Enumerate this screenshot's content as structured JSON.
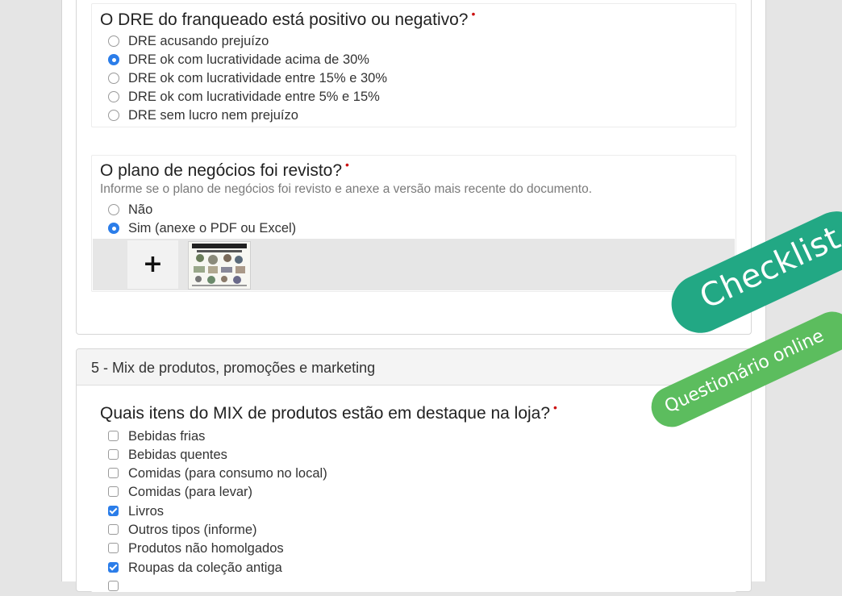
{
  "section_dre": {
    "question": "O DRE do franqueado está positivo ou negativo?",
    "required_mark": "•",
    "options": [
      {
        "label": "DRE acusando prejuízo",
        "selected": false
      },
      {
        "label": "DRE ok com lucratividade acima de 30%",
        "selected": true
      },
      {
        "label": "DRE ok com lucratividade entre 15% e 30%",
        "selected": false
      },
      {
        "label": "DRE ok com lucratividade entre 5% e 15%",
        "selected": false
      },
      {
        "label": "DRE sem lucro nem prejuízo",
        "selected": false
      }
    ]
  },
  "section_plano": {
    "question": "O plano de negócios foi revisto?",
    "required_mark": "•",
    "help": "Informe se o plano de negócios foi revisto e anexe a versão mais recente do documento.",
    "options": [
      {
        "label": "Não",
        "selected": false
      },
      {
        "label": "Sim (anexe o PDF ou Excel)",
        "selected": true
      }
    ],
    "add_attachment_label": "+"
  },
  "section5": {
    "header": "5 - Mix de produtos, promoções e marketing",
    "question": "Quais itens do MIX de produtos estão em destaque na loja?",
    "required_mark": "•",
    "options": [
      {
        "label": "Bebidas frias",
        "checked": false
      },
      {
        "label": "Bebidas quentes",
        "checked": false
      },
      {
        "label": "Comidas (para consumo no local)",
        "checked": false
      },
      {
        "label": "Comidas (para levar)",
        "checked": false
      },
      {
        "label": "Livros",
        "checked": true
      },
      {
        "label": "Outros tipos (informe)",
        "checked": false
      },
      {
        "label": "Produtos não homolgados",
        "checked": false
      },
      {
        "label": "Roupas da coleção antiga",
        "checked": true
      }
    ]
  },
  "badges": {
    "checklist": "Checklist",
    "online": "Questionário online",
    "checklist_color": "#22a884",
    "online_color": "#5cbd5e"
  },
  "colors": {
    "accent": "#2b7de9",
    "required": "#cc1111"
  }
}
